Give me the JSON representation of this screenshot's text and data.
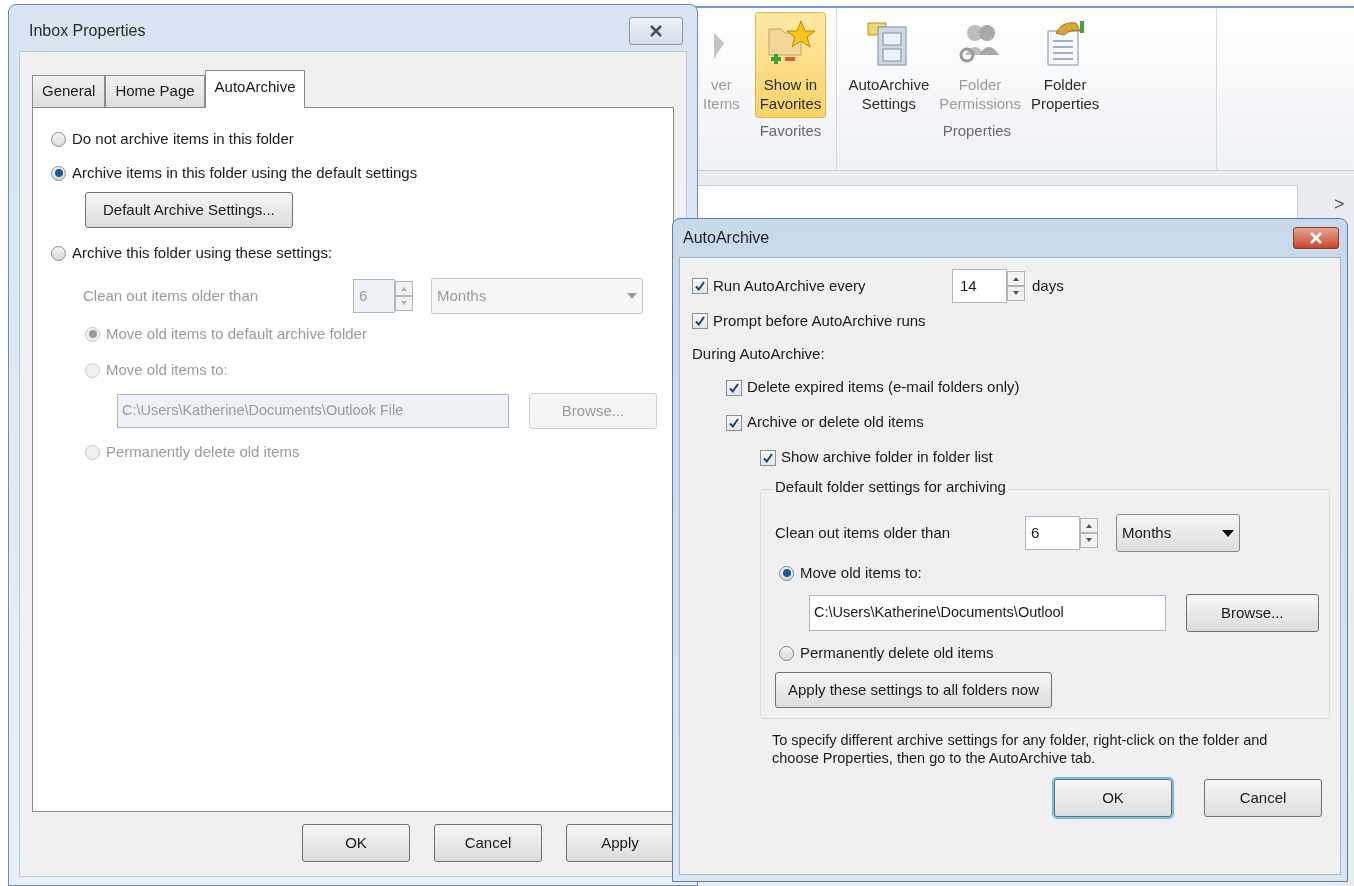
{
  "ribbon": {
    "buttons": [
      {
        "kind": "partial",
        "lines": [
          "ver",
          "Items"
        ],
        "disabled": true,
        "selected": false
      },
      {
        "kind": "favorites",
        "lines": [
          "Show in",
          "Favorites"
        ],
        "disabled": false,
        "selected": true
      },
      {
        "kind": "archive",
        "lines": [
          "AutoArchive",
          "Settings"
        ],
        "disabled": false,
        "selected": false
      },
      {
        "kind": "permissions",
        "lines": [
          "Folder",
          "Permissions"
        ],
        "disabled": true,
        "selected": false
      },
      {
        "kind": "properties",
        "lines": [
          "Folder",
          "Properties"
        ],
        "disabled": false,
        "selected": false
      }
    ],
    "groups": [
      "Favorites",
      "Properties"
    ]
  },
  "content": {
    "scroll_arrow": ">"
  },
  "inbox_properties": {
    "title": "Inbox Properties",
    "tabs": [
      {
        "label": "General",
        "selected": false
      },
      {
        "label": "Home Page",
        "selected": false
      },
      {
        "label": "AutoArchive",
        "selected": true
      }
    ],
    "modes": [
      {
        "label": "Do not archive items in this folder",
        "selected": false
      },
      {
        "label": "Archive items in this folder using the default settings",
        "selected": true
      },
      {
        "label": "Archive this folder using these settings:",
        "selected": false
      }
    ],
    "default_settings_button": "Default Archive Settings...",
    "custom": {
      "disabled": true,
      "clean_label": "Clean out items older than",
      "number": "6",
      "unit": "Months",
      "targets": [
        {
          "label": "Move old items to default archive folder",
          "selected": true
        },
        {
          "label": "Move old items to:",
          "selected": false
        },
        {
          "label": "Permanently delete old items",
          "selected": false
        }
      ],
      "path": "C:\\Users\\Katherine\\Documents\\Outlook File",
      "browse": "Browse..."
    },
    "buttons": [
      "OK",
      "Cancel",
      "Apply"
    ]
  },
  "autoarchive": {
    "title": "AutoArchive",
    "run_every": {
      "label": "Run AutoArchive every",
      "checked": true,
      "value": "14",
      "unit": "days"
    },
    "prompt": {
      "label": "Prompt before AutoArchive runs",
      "checked": true
    },
    "during_label": "During AutoArchive:",
    "delete_expired": {
      "label": "Delete expired items (e-mail folders only)",
      "checked": true
    },
    "archive_old": {
      "label": "Archive or delete old items",
      "checked": true
    },
    "show_folder": {
      "label": "Show archive folder in folder list",
      "checked": true
    },
    "group_title": "Default folder settings for archiving",
    "clean_label": "Clean out items older than",
    "number": "6",
    "unit": "Months",
    "targets": [
      {
        "label": "Move old items to:",
        "selected": true
      },
      {
        "label": "Permanently delete old items",
        "selected": false
      }
    ],
    "path": "C:\\Users\\Katherine\\Documents\\Outlool",
    "browse": "Browse...",
    "apply_all": "Apply these settings to all folders now",
    "note": "To specify different archive settings for any folder, right-click on the folder and choose Properties, then go to the AutoArchive tab.",
    "buttons": [
      {
        "label": "OK",
        "default": true
      },
      {
        "label": "Cancel",
        "default": false
      }
    ]
  }
}
